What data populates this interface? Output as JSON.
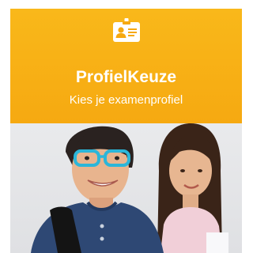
{
  "tile": {
    "title": "ProfielKeuze",
    "subtitle": "Kies je examenprofiel",
    "icon": "id-badge-icon",
    "photo": "students-photo"
  },
  "colors": {
    "banner": "#f6a911",
    "text": "#ffffff"
  }
}
